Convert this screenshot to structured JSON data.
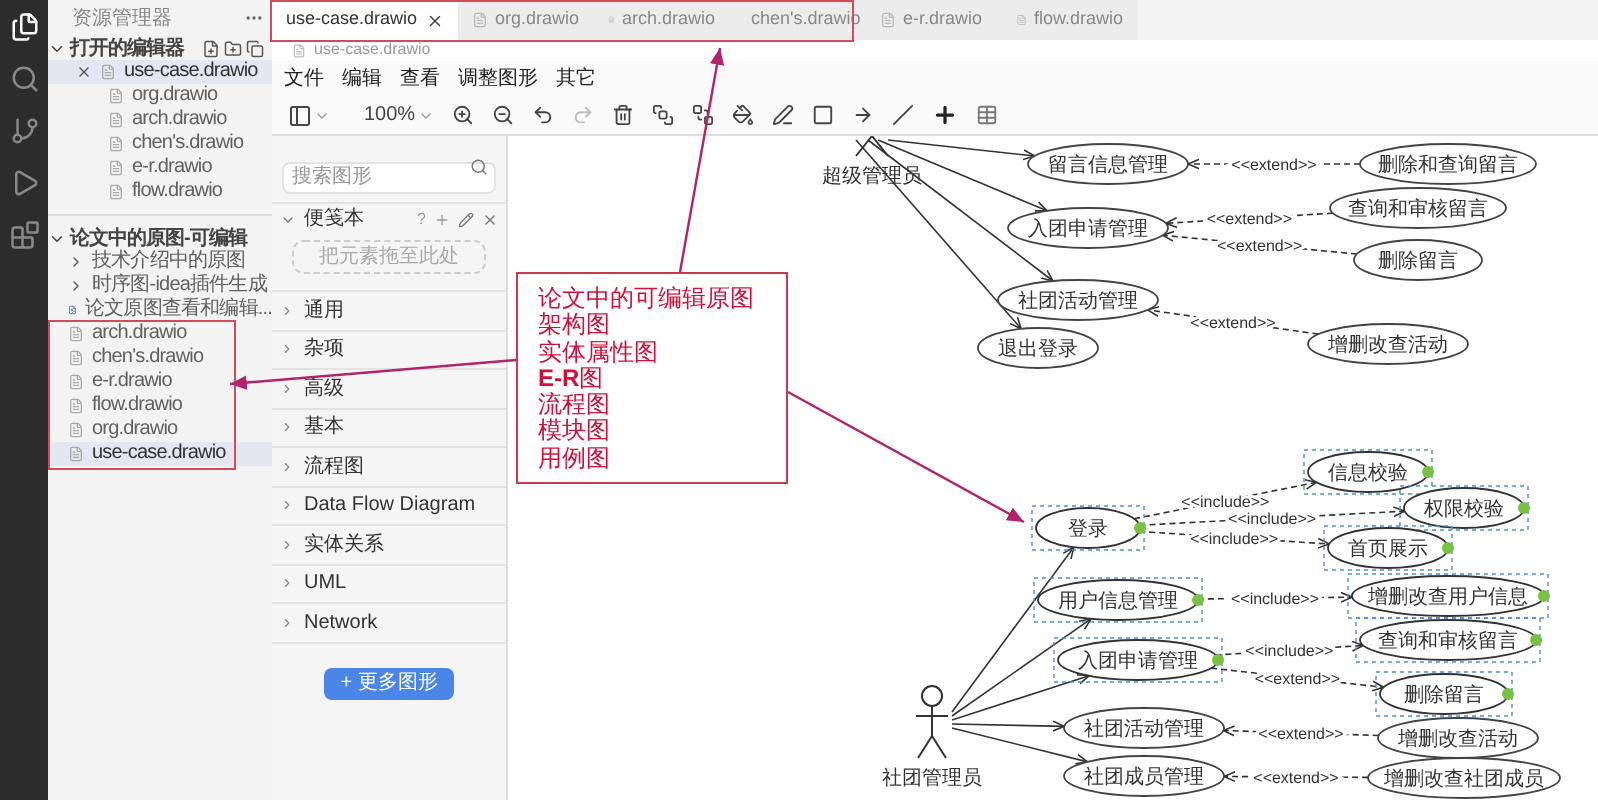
{
  "explorer": {
    "title": "资源管理器",
    "open_editors": {
      "title": "打开的编辑器",
      "expanded": true,
      "files": [
        {
          "name": "use-case.drawio",
          "selected": true
        },
        {
          "name": "org.drawio",
          "selected": false
        },
        {
          "name": "arch.drawio",
          "selected": false
        },
        {
          "name": "chen's.drawio",
          "selected": false
        },
        {
          "name": "e-r.drawio",
          "selected": false
        },
        {
          "name": "flow.drawio",
          "selected": false
        }
      ]
    },
    "folder": {
      "title": "论文中的原图-可编辑",
      "expanded": true,
      "items": [
        {
          "kind": "folder",
          "name": "技术介绍中的原图",
          "selected": false
        },
        {
          "kind": "folder",
          "name": "时序图-idea插件生成",
          "selected": false
        },
        {
          "kind": "document",
          "name": "论文原图查看和编辑...",
          "selected": false
        },
        {
          "kind": "file",
          "name": "arch.drawio",
          "selected": false
        },
        {
          "kind": "file",
          "name": "chen's.drawio",
          "selected": false
        },
        {
          "kind": "file",
          "name": "e-r.drawio",
          "selected": false
        },
        {
          "kind": "file",
          "name": "flow.drawio",
          "selected": false
        },
        {
          "kind": "file",
          "name": "org.drawio",
          "selected": false
        },
        {
          "kind": "file",
          "name": "use-case.drawio",
          "selected": true
        }
      ]
    }
  },
  "tabs": [
    {
      "label": "use-case.drawio",
      "selected": true
    },
    {
      "label": "org.drawio",
      "selected": false
    },
    {
      "label": "arch.drawio",
      "selected": false
    },
    {
      "label": "chen's.drawio",
      "selected": false
    },
    {
      "label": "e-r.drawio",
      "selected": false
    },
    {
      "label": "flow.drawio",
      "selected": false
    }
  ],
  "breadcrumb": "use-case.drawio",
  "menu": [
    "文件",
    "编辑",
    "查看",
    "调整图形",
    "其它"
  ],
  "toolbar": {
    "zoom": "100%"
  },
  "shapes_panel": {
    "search": {
      "placeholder": "搜索图形"
    },
    "scratchpad": {
      "title": "便笺本",
      "help": "?",
      "drop_hint": "把元素拖至此处"
    },
    "categories": [
      "通用",
      "杂项",
      "高级",
      "基本",
      "流程图",
      "Data Flow Diagram",
      "实体关系",
      "UML",
      "Network"
    ],
    "more_button": "+ 更多图形"
  },
  "diagram": {
    "actors": [
      {
        "label": "超级管理员"
      },
      {
        "label": "社团管理员"
      }
    ],
    "use_cases": [
      {
        "label": "留言信息管理",
        "selected": false
      },
      {
        "label": "删除和查询留言",
        "selected": false
      },
      {
        "label": "入团申请管理",
        "selected": false
      },
      {
        "label": "查询和审核留言",
        "selected": false
      },
      {
        "label": "删除留言",
        "selected": false
      },
      {
        "label": "社团活动管理",
        "selected": false
      },
      {
        "label": "增删改查活动",
        "selected": false
      },
      {
        "label": "退出登录",
        "selected": false
      },
      {
        "label": "登录",
        "selected": true
      },
      {
        "label": "信息校验",
        "selected": true
      },
      {
        "label": "权限校验",
        "selected": true
      },
      {
        "label": "首页展示",
        "selected": true
      },
      {
        "label": "用户信息管理",
        "selected": true
      },
      {
        "label": "增删改查用户信息",
        "selected": true
      },
      {
        "label": "入团申请管理",
        "selected": true
      },
      {
        "label": "查询和审核留言",
        "selected": true
      },
      {
        "label": "删除留言",
        "selected": true
      },
      {
        "label": "社团活动管理",
        "selected": false
      },
      {
        "label": "增删改查活动",
        "selected": false
      },
      {
        "label": "社团成员管理",
        "selected": false
      },
      {
        "label": "增删改查社团成员",
        "selected": false
      }
    ],
    "connector_labels": [
      "<<extend>>",
      "<<extend>>",
      "<<extend>>",
      "<<extend>>",
      "<<include>>",
      "<<include>>",
      "<<include>>",
      "<<include>>",
      "<<include>>",
      "<<extend>>",
      "<<extend>>",
      "<<extend>>"
    ]
  },
  "callout": {
    "lines": [
      "论文中的可编辑原图",
      "架构图",
      "实体属性图",
      "**E-R**图",
      "流程图",
      "模块图",
      "用例图"
    ]
  }
}
